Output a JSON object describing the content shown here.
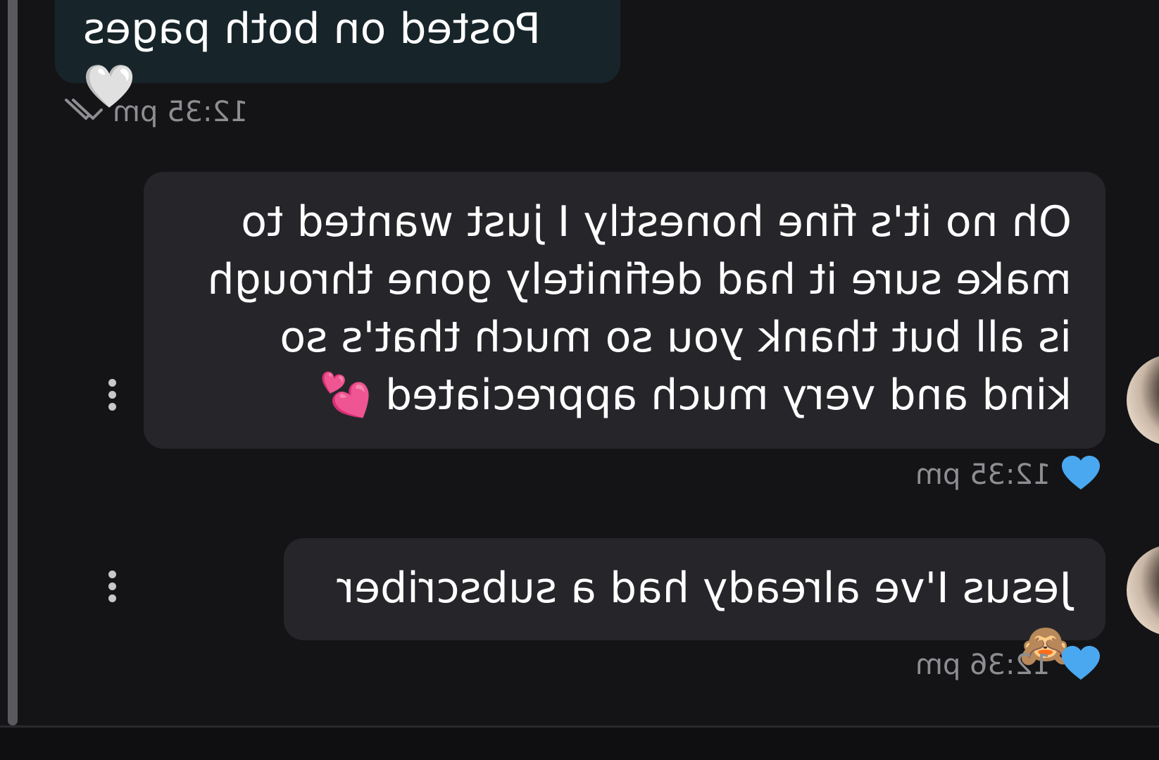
{
  "conversation": {
    "messages": [
      {
        "direction": "sent",
        "text": "Posted on both pages",
        "emoji": "🤍",
        "time": "12:35 pm",
        "status_icon": "double-check-icon"
      },
      {
        "direction": "received",
        "text": "Oh no it's fine honestly I just wanted to make sure it had definitely gone through is all but thank you so much that's so kind and very much appreciated",
        "emoji": "💕",
        "time": "12:35 pm",
        "reaction_icon": "heart-icon"
      },
      {
        "direction": "received",
        "text": "Jesus I've already had a subscriber",
        "emoji": "🙈",
        "time": "12:36 pm",
        "reaction_icon": "heart-icon"
      }
    ]
  },
  "colors": {
    "background": "#141416",
    "sent_bubble": "#17252b",
    "received_bubble": "#26262a",
    "timestamp": "#8d8d92",
    "reaction_heart": "#4aa8f0"
  }
}
